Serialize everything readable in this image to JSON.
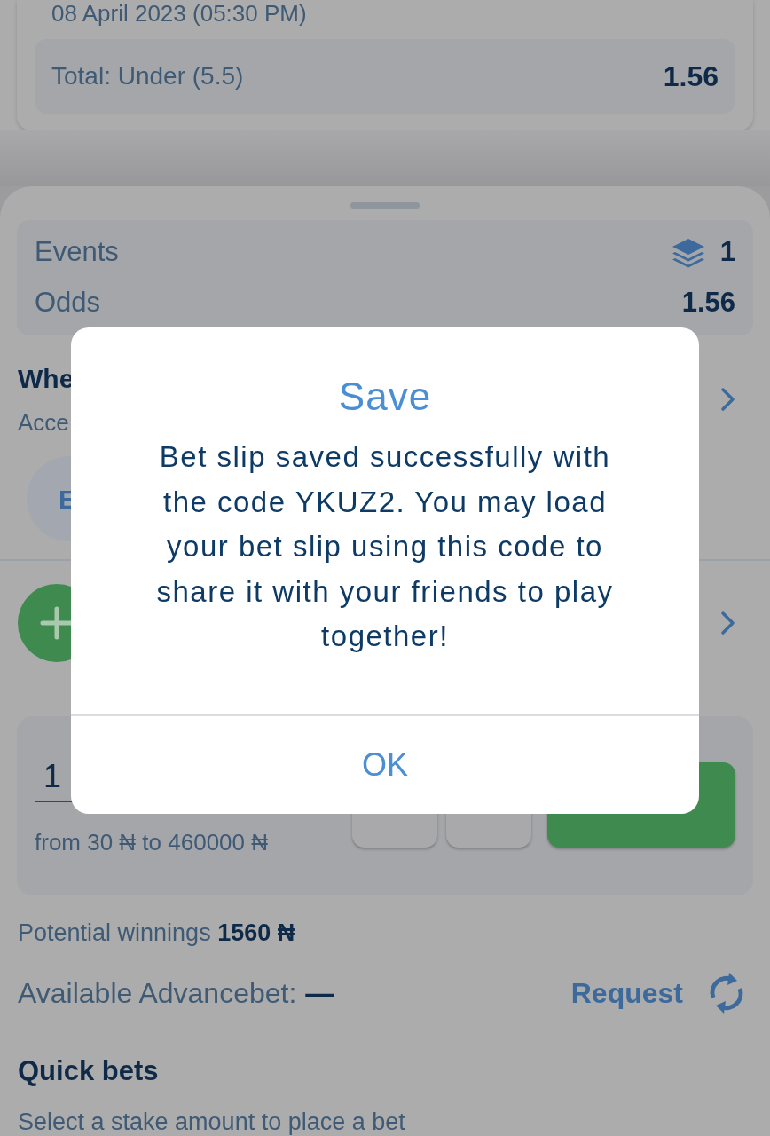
{
  "event_card": {
    "date": "08 April 2023 (05:30 PM)",
    "market": "Total: Under (5.5)",
    "odds": "1.56"
  },
  "bet_slip": {
    "summary": [
      {
        "label": "Events",
        "value": "1",
        "kind": "count"
      },
      {
        "label": "Odds",
        "value": "1.56",
        "kind": "plain"
      }
    ],
    "settings_row": {
      "title": "Whe",
      "subtitle": "Acce"
    },
    "chip": "E",
    "stake": {
      "value": "1",
      "range": "from 30 ₦ to 460000 ₦"
    },
    "potential_winnings": {
      "label": "Potential winnings",
      "amount": "1560 ₦"
    },
    "advancebet": {
      "label": "Available Advancebet:",
      "value": "—",
      "action": "Request"
    },
    "quick_bets": {
      "title": "Quick bets",
      "subtitle": "Select a stake amount to place a bet"
    }
  },
  "dialog": {
    "title": "Save",
    "message": "Bet slip saved successfully with the code YKUZ2. You may load your bet slip using this code to share it with your friends to play together!",
    "button": "OK"
  }
}
